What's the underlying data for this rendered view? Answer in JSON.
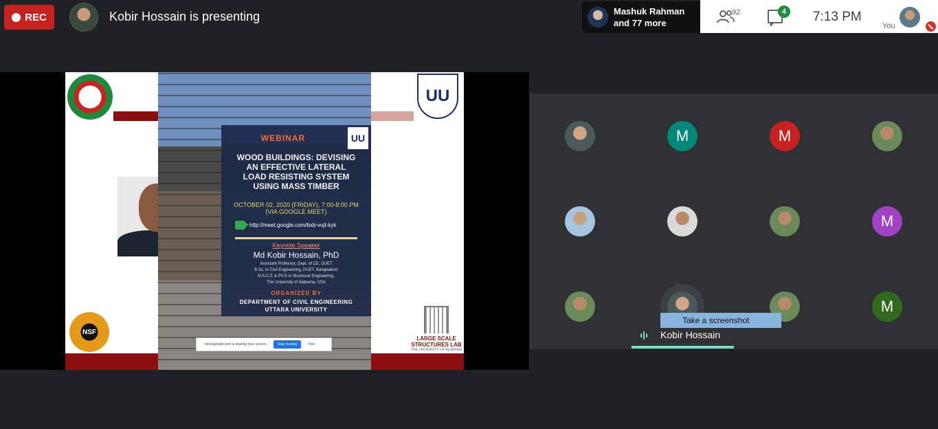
{
  "topbar": {
    "rec_label": "REC",
    "presenting_text": "Kobir Hossain is presenting",
    "participant_summary_line1": "Mashuk Rahman",
    "participant_summary_line2": "and 77 more",
    "people_count": "92",
    "chat_badge": "4",
    "time": "7:13  PM",
    "you_label": "You"
  },
  "slide": {
    "webinar": "WEBINAR",
    "title_line1": "WOOD BUILDINGS: DEVISING",
    "title_line2": "AN EFFECTIVE LATERAL",
    "title_line3": "LOAD RESISTING SYSTEM",
    "title_line4": "USING MASS TIMBER",
    "date_line1": "OCTOBER 02, 2020 (FRIDAY), 7:00-8:00 PM",
    "date_line2": "(VIA GOOGLE MEET)",
    "link": "http://meet.google.com/bxb-vujt-kyk",
    "keynote_label": "Keynote Speaker",
    "speaker_name": "Md Kobir Hossain, PhD",
    "cred_line1": "Assistant Professor, Dept. of CE, DUET",
    "cred_line2": "B.Sc. in Civil Engineering, DUET, Bangladesh",
    "cred_line3": "M.S.C.E & Ph.D in Structural Engineering,",
    "cred_line4": "The University of Alabama, USA",
    "organized_by": "ORGANIZED BY",
    "dept_line1": "DEPARTMENT OF CIVIL ENGINEERING",
    "dept_line2": "UTTARA UNIVERSITY",
    "nsf_label": "NSF",
    "lsl_line1": "LARGE SCALE",
    "lsl_line2": "STRUCTURES LAB",
    "lsl_line3": "THE UNIVERSITY OF ALABAMA",
    "sharing_text": "meet.google.com is sharing your screen.",
    "stop_sharing": "Stop sharing",
    "hide": "Hide"
  },
  "participants": {
    "tiles": [
      {
        "initial": ""
      },
      {
        "initial": "M",
        "color": "#00897b"
      },
      {
        "initial": "M",
        "color": "#c5221f"
      },
      {
        "initial": ""
      },
      {
        "initial": ""
      },
      {
        "initial": ""
      },
      {
        "initial": ""
      },
      {
        "initial": "M",
        "color": "#a142c4"
      },
      {
        "initial": ""
      },
      {
        "initial": ""
      },
      {
        "initial": ""
      },
      {
        "initial": "M",
        "color": "#33691e"
      }
    ],
    "tooltip": "Take a screenshot",
    "active_name": "Kobir Hossain"
  }
}
